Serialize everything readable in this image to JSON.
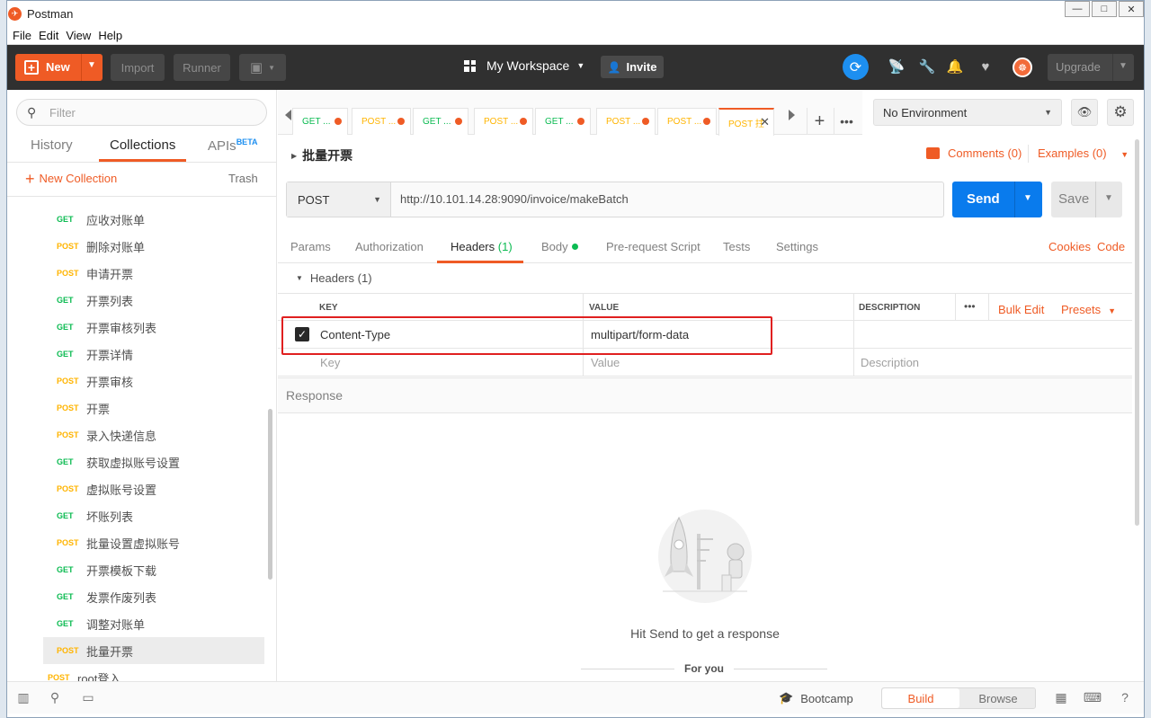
{
  "window": {
    "title": "Postman",
    "controls": [
      "—",
      "□",
      "✕"
    ]
  },
  "menu": [
    "File",
    "Edit",
    "View",
    "Help"
  ],
  "header": {
    "new_label": "New",
    "import_label": "Import",
    "runner_label": "Runner",
    "workspace_label": "My Workspace",
    "invite_label": "Invite",
    "upgrade_label": "Upgrade"
  },
  "sidebar": {
    "filter_placeholder": "Filter",
    "tabs": [
      "History",
      "Collections",
      "APIs"
    ],
    "apis_badge": "BETA",
    "active_tab": "Collections",
    "new_collection_label": "New Collection",
    "trash_label": "Trash",
    "requests": [
      {
        "method": "GET",
        "name": "应收对账单"
      },
      {
        "method": "POST",
        "name": "删除对账单"
      },
      {
        "method": "POST",
        "name": "申请开票"
      },
      {
        "method": "GET",
        "name": "开票列表"
      },
      {
        "method": "GET",
        "name": "开票审核列表"
      },
      {
        "method": "GET",
        "name": "开票详情"
      },
      {
        "method": "POST",
        "name": "开票审核"
      },
      {
        "method": "POST",
        "name": "开票"
      },
      {
        "method": "POST",
        "name": "录入快递信息"
      },
      {
        "method": "GET",
        "name": "获取虚拟账号设置"
      },
      {
        "method": "POST",
        "name": "虚拟账号设置"
      },
      {
        "method": "GET",
        "name": "坏账列表"
      },
      {
        "method": "POST",
        "name": "批量设置虚拟账号"
      },
      {
        "method": "GET",
        "name": "开票模板下载"
      },
      {
        "method": "GET",
        "name": "发票作废列表"
      },
      {
        "method": "GET",
        "name": "调整对账单"
      },
      {
        "method": "POST",
        "name": "批量开票",
        "selected": true
      }
    ],
    "root_request": {
      "method": "POST",
      "name": "root登入"
    }
  },
  "tabs": [
    {
      "method": "GET",
      "label": "GET ..."
    },
    {
      "method": "POST",
      "label": "POST ..."
    },
    {
      "method": "GET",
      "label": "GET ..."
    },
    {
      "method": "POST",
      "label": "POST ..."
    },
    {
      "method": "GET",
      "label": "GET ..."
    },
    {
      "method": "POST",
      "label": "POST ..."
    },
    {
      "method": "POST",
      "label": "POST ..."
    },
    {
      "method": "POST",
      "label": "POST 拄",
      "active": true
    }
  ],
  "environment": {
    "selected": "No Environment"
  },
  "request": {
    "name": "批量开票",
    "comments_label": "Comments (0)",
    "examples_label": "Examples (0)",
    "method": "POST",
    "url": "http://10.101.14.28:9090/invoice/makeBatch",
    "send_label": "Send",
    "save_label": "Save",
    "tabs": [
      "Params",
      "Authorization",
      "Headers",
      "Body",
      "Pre-request Script",
      "Tests",
      "Settings"
    ],
    "headers_count": "(1)",
    "cookies_label": "Cookies",
    "code_label": "Code"
  },
  "headers_section": {
    "title": "Headers (1)",
    "columns": {
      "key": "KEY",
      "value": "VALUE",
      "description": "DESCRIPTION"
    },
    "bulk_edit_label": "Bulk Edit",
    "presets_label": "Presets",
    "rows": [
      {
        "key": "Content-Type",
        "value": "multipart/form-data",
        "checked": true
      }
    ],
    "placeholders": {
      "key": "Key",
      "value": "Value",
      "description": "Description"
    }
  },
  "response": {
    "title": "Response",
    "hint": "Hit Send to get a response",
    "for_you": "For you"
  },
  "footer": {
    "bootcamp_label": "Bootcamp",
    "build_label": "Build",
    "browse_label": "Browse"
  },
  "colors": {
    "accent": "#ef5b25",
    "send_blue": "#097bed",
    "get_green": "#0cbb52",
    "post_yellow": "#ffb400",
    "highlight_red": "#e02020"
  }
}
